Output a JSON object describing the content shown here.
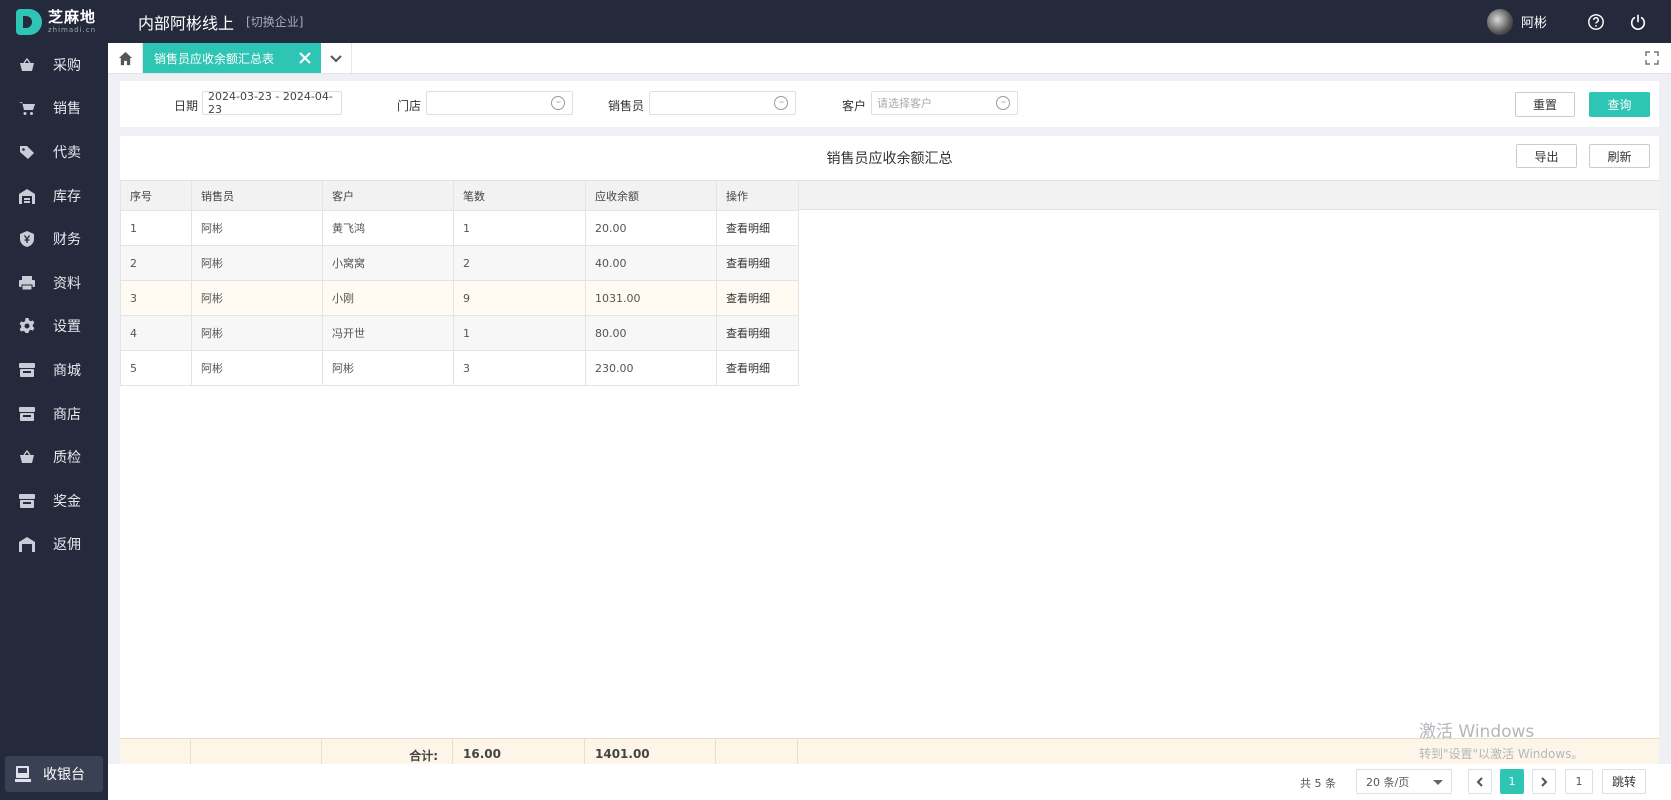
{
  "header": {
    "logo_cn": "芝麻地",
    "logo_en": "zhimadi.cn",
    "company": "内部阿彬线上",
    "switch_company": "[切换企业]",
    "username": "阿彬"
  },
  "sidebar": {
    "items": [
      {
        "label": "采购",
        "icon": "basket-icon"
      },
      {
        "label": "销售",
        "icon": "cart-icon"
      },
      {
        "label": "代卖",
        "icon": "tag-icon"
      },
      {
        "label": "库存",
        "icon": "warehouse-icon"
      },
      {
        "label": "财务",
        "icon": "shield-yen-icon"
      },
      {
        "label": "资料",
        "icon": "printer-icon"
      },
      {
        "label": "设置",
        "icon": "gear-icon"
      },
      {
        "label": "商城",
        "icon": "store-icon"
      },
      {
        "label": "商店",
        "icon": "shop-icon"
      },
      {
        "label": "质检",
        "icon": "basket-check-icon"
      },
      {
        "label": "奖金",
        "icon": "bonus-icon"
      },
      {
        "label": "返佣",
        "icon": "rebate-icon"
      }
    ],
    "cashier": "收银台"
  },
  "tabs": {
    "active": "销售员应收余额汇总表"
  },
  "filters": {
    "date_label": "日期",
    "date_value": "2024-03-23 - 2024-04-23",
    "store_label": "门店",
    "store_value": "",
    "salesperson_label": "销售员",
    "salesperson_value": "",
    "customer_label": "客户",
    "customer_placeholder": "请选择客户",
    "reset": "重置",
    "query": "查询"
  },
  "report": {
    "title": "销售员应收余额汇总",
    "export": "导出",
    "refresh": "刷新",
    "columns": [
      "序号",
      "销售员",
      "客户",
      "笔数",
      "应收余额",
      "操作"
    ],
    "rows": [
      {
        "no": "1",
        "salesperson": "阿彬",
        "customer": "黄飞鸿",
        "count": "1",
        "balance": "20.00",
        "action": "查看明细"
      },
      {
        "no": "2",
        "salesperson": "阿彬",
        "customer": "小窝窝",
        "count": "2",
        "balance": "40.00",
        "action": "查看明细"
      },
      {
        "no": "3",
        "salesperson": "阿彬",
        "customer": "小刚",
        "count": "9",
        "balance": "1031.00",
        "action": "查看明细"
      },
      {
        "no": "4",
        "salesperson": "阿彬",
        "customer": "冯开世",
        "count": "1",
        "balance": "80.00",
        "action": "查看明细"
      },
      {
        "no": "5",
        "salesperson": "阿彬",
        "customer": "阿彬",
        "count": "3",
        "balance": "230.00",
        "action": "查看明细"
      }
    ],
    "total_label": "合计:",
    "total_count": "16.00",
    "total_balance": "1401.00"
  },
  "pagination": {
    "total": "共 5 条",
    "page_size": "20 条/页",
    "current_page": "1",
    "jump_input": "1",
    "jump": "跳转"
  },
  "watermark": {
    "line1": "激活 Windows",
    "line2": "转到\"设置\"以激活 Windows。"
  },
  "colors": {
    "accent": "#2fc5b4",
    "sidebar_bg": "#242a3c",
    "footer_bg": "#fdf6e8"
  }
}
